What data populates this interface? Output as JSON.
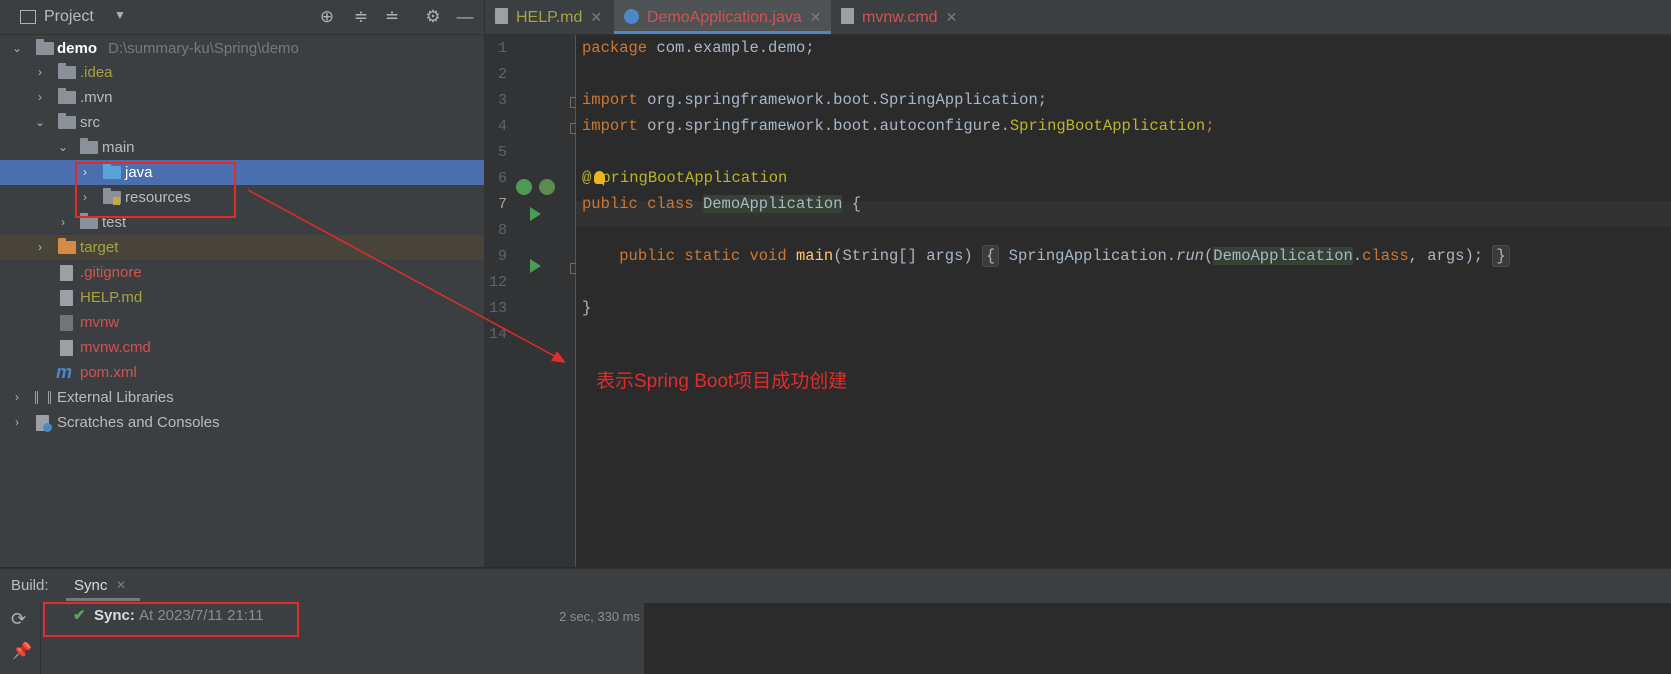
{
  "project_panel": {
    "title": "Project",
    "toolbar_icons": [
      "locate-icon",
      "expand-all-icon",
      "collapse-all-icon",
      "gear-icon",
      "minimize-icon"
    ],
    "tree": [
      {
        "label": "demo",
        "path": "D:\\summary-ku\\Spring\\demo",
        "depth": 0,
        "expanded": true,
        "icon": "module-folder-icon",
        "color": "normal"
      },
      {
        "label": ".idea",
        "depth": 1,
        "expanded": false,
        "icon": "folder-icon",
        "color": "yellow"
      },
      {
        "label": ".mvn",
        "depth": 1,
        "expanded": false,
        "icon": "folder-icon",
        "color": "normal"
      },
      {
        "label": "src",
        "depth": 1,
        "expanded": true,
        "icon": "folder-icon",
        "color": "normal"
      },
      {
        "label": "main",
        "depth": 2,
        "expanded": true,
        "icon": "folder-icon",
        "color": "normal"
      },
      {
        "label": "java",
        "depth": 3,
        "expanded": false,
        "icon": "source-folder-icon",
        "color": "normal",
        "selected": true
      },
      {
        "label": "resources",
        "depth": 3,
        "expanded": false,
        "icon": "resources-folder-icon",
        "color": "normal"
      },
      {
        "label": "test",
        "depth": 2,
        "expanded": false,
        "icon": "folder-icon",
        "color": "normal"
      },
      {
        "label": "target",
        "depth": 1,
        "expanded": false,
        "icon": "excluded-folder-icon",
        "color": "yellow"
      },
      {
        "label": ".gitignore",
        "depth": 1,
        "icon": "ignore-file-icon",
        "color": "red"
      },
      {
        "label": "HELP.md",
        "depth": 1,
        "icon": "markdown-file-icon",
        "color": "yellow"
      },
      {
        "label": "mvnw",
        "depth": 1,
        "icon": "shell-file-icon",
        "color": "red"
      },
      {
        "label": "mvnw.cmd",
        "depth": 1,
        "icon": "text-file-icon",
        "color": "red"
      },
      {
        "label": "pom.xml",
        "depth": 1,
        "icon": "maven-file-icon",
        "color": "red"
      },
      {
        "label": "External Libraries",
        "depth": 0,
        "expanded": false,
        "icon": "libraries-icon",
        "color": "normal"
      },
      {
        "label": "Scratches and Consoles",
        "depth": 0,
        "expanded": false,
        "icon": "scratches-icon",
        "color": "normal"
      }
    ]
  },
  "editor": {
    "tabs": [
      {
        "label": "HELP.md",
        "color": "yellow",
        "active": false
      },
      {
        "label": "DemoApplication.java",
        "color": "red",
        "active": true
      },
      {
        "label": "mvnw.cmd",
        "color": "red",
        "active": false
      }
    ],
    "line_numbers": [
      "1",
      "2",
      "3",
      "4",
      "5",
      "6",
      "7",
      "8",
      "9",
      "12",
      "13",
      "14"
    ],
    "current_line": "7",
    "code": {
      "l1_kw": "package",
      "l1_rest": " com.example.demo;",
      "l3_kw": "import",
      "l3_rest": " org.springframework.boot.SpringApplication;",
      "l4_kw": "import",
      "l4_pkg": " org.springframework.boot.autoconfigure.",
      "l4_cls": "SpringBootApplication",
      "l4_end": ";",
      "l6_at": "@",
      "l6_rest": "pringBootApplication",
      "l7_kw": "public class",
      "l7_sp": " ",
      "l7_cls": "DemoApplication",
      "l7_end": " {",
      "l9_kw": "public static void",
      "l9_fn": "main",
      "l9_args": "(String[] args)",
      "l9_ob": "{",
      "l9_call1": " SpringApplication.",
      "l9_run": "run",
      "l9_p": "(",
      "l9_cls": "DemoApplication",
      "l9_dot": ".",
      "l9_class": "class",
      "l9_tail": ", args);",
      "l9_cb": "}",
      "l13": "}"
    }
  },
  "annotation": {
    "note": "表示Spring Boot项目成功创建"
  },
  "build_panel": {
    "label": "Build:",
    "tab": "Sync",
    "status_label": "Sync:",
    "status_time": "At 2023/7/11 21:11",
    "duration": "2 sec, 330 ms"
  }
}
